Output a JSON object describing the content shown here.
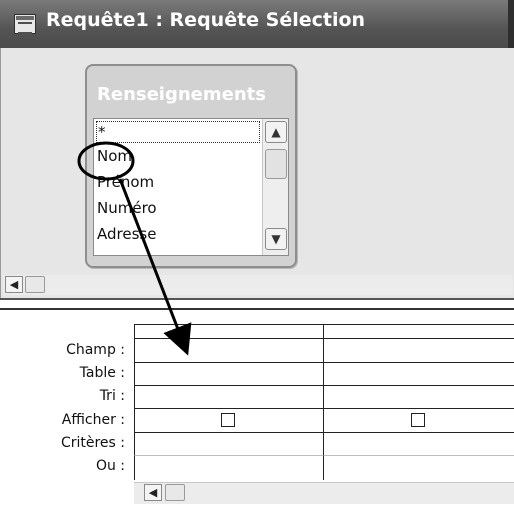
{
  "window": {
    "title": "Requête1 : Requête Sélection"
  },
  "table": {
    "name": "Renseignements",
    "fields": [
      "*",
      "Nom",
      "Prénom",
      "Numéro",
      "Adresse"
    ],
    "selected_field": "*"
  },
  "scroll": {
    "up_glyph": "▲",
    "down_glyph": "▼",
    "left_glyph": "◀"
  },
  "grid": {
    "row_labels": [
      "Champ :",
      "Table :",
      "Tri :",
      "Afficher :",
      "Critères :",
      "Ou :"
    ],
    "columns": [
      {
        "champ": "",
        "table": "",
        "tri": "",
        "afficher": false,
        "criteres": "",
        "ou": ""
      },
      {
        "champ": "",
        "table": "",
        "tri": "",
        "afficher": false,
        "criteres": "",
        "ou": ""
      }
    ]
  },
  "annotation": {
    "type": "circle-and-arrow",
    "from_field": "Nom",
    "to_cell": "Champ, column 1",
    "color": "#000000"
  }
}
